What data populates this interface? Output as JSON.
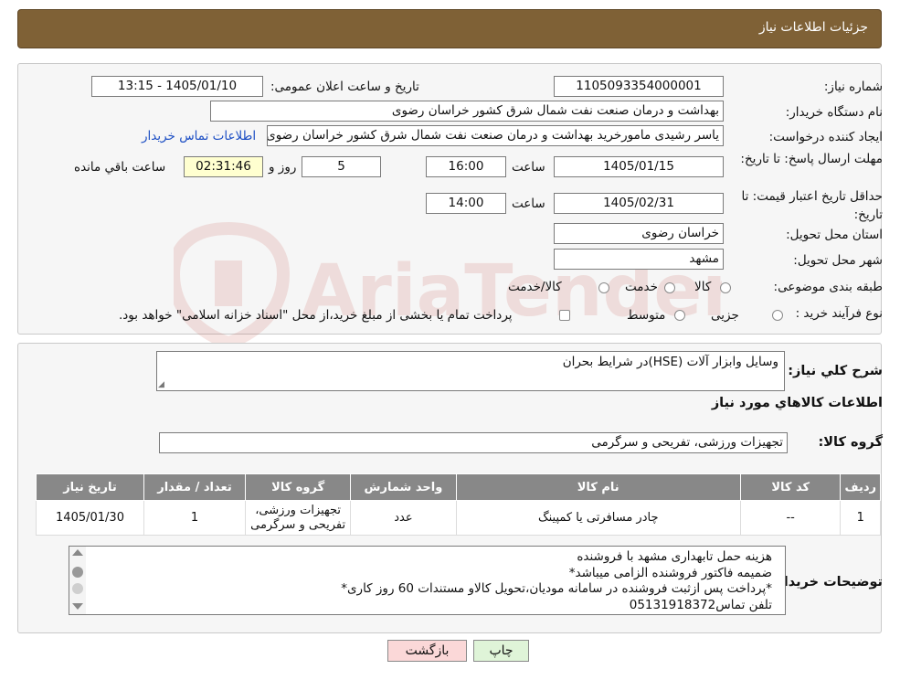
{
  "header": {
    "title": "جزئیات اطلاعات نیاز"
  },
  "form": {
    "need_number_label": "شماره نیاز:",
    "need_number": "1105093354000001",
    "announce_label": "تاریخ و ساعت اعلان عمومی:",
    "announce_value": "1405/01/10 - 13:15",
    "buyer_org_label": "نام دستگاه خریدار:",
    "buyer_org": "بهداشت و درمان صنعت نفت شمال شرق کشور   خراسان رضوی",
    "creator_label": "ایجاد کننده درخواست:",
    "creator": "یاسر رشیدی مامورخرید بهداشت و درمان صنعت نفت شمال شرق کشور   خراسان رضوی",
    "contact_link": "اطلاعات تماس خریدار",
    "reply_deadline_label": "مهلت ارسال پاسخ: تا تاریخ:",
    "reply_date": "1405/01/15",
    "time_label": "ساعت",
    "reply_time": "16:00",
    "days_value": "5",
    "days_label": "روز و",
    "remaining_time": "02:31:46",
    "remaining_label": "ساعت باقي مانده",
    "price_validity_label": "حداقل تاريخ اعتبار قيمت: تا تاریخ:",
    "price_date": "1405/02/31",
    "price_time": "14:00",
    "province_label": "استان محل تحویل:",
    "province": "خراسان رضوی",
    "city_label": "شهر محل تحویل:",
    "city": "مشهد",
    "category_label": "طبقه بندی موضوعی:",
    "category_options": [
      "کالا",
      "خدمت",
      "کالا/خدمت"
    ],
    "process_label": "نوع فرآیند خرید :",
    "process_options": [
      "جزیی",
      "متوسط"
    ],
    "process_note": "پرداخت تمام یا بخشی از مبلغ خرید،از محل \"اسناد خزانه اسلامی\" خواهد بود."
  },
  "summary": {
    "desc_label": "شرح کلي نياز:",
    "desc_value": "وسايل وابزار آلات (HSE)در شرايط بحران",
    "goods_info_title": "اطلاعات کالاهاي مورد نياز",
    "group_label": "گروه کالا:",
    "group_value": "تجهیزات ورزشی، تفریحی و سرگرمی"
  },
  "table": {
    "headers": [
      "رديف",
      "کد کالا",
      "نام کالا",
      "واحد شمارش",
      "گروه کالا",
      "تعداد / مقدار",
      "تاریخ نیاز"
    ],
    "rows": [
      [
        "1",
        "--",
        "چادر مسافرتی یا کمپینگ",
        "عدد",
        "تجهیزات ورزشی، تفریحی و سرگرمی",
        "1",
        "1405/01/30"
      ]
    ]
  },
  "notes": {
    "label": "توضیحات خریدار:",
    "lines": [
      "هزینه حمل تابهداری مشهد با فروشنده",
      "ضمیمه فاکتور فروشنده الزامی میباشد*",
      "*پرداخت پس ازثبت فروشنده در سامانه مودیان،تحویل کالاو مستندات 60 روز کاری*",
      "تلفن تماس05131918372"
    ]
  },
  "buttons": {
    "print": "چاپ",
    "back": "بازگشت"
  },
  "watermark": {
    "text": "AriaTender.neT"
  },
  "colors": {
    "header_bg": "#7f6136",
    "table_header_bg": "#888888",
    "link": "#1d4fc4",
    "highlight": "#ffffd0"
  }
}
